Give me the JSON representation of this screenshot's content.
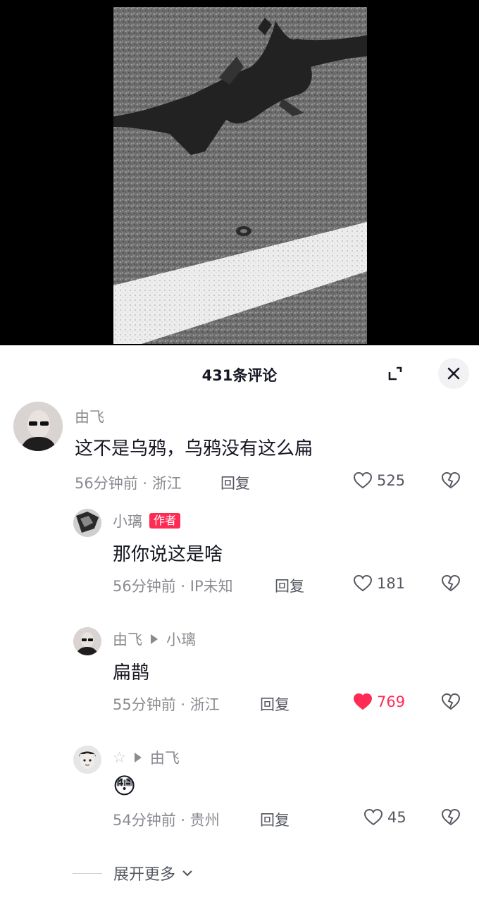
{
  "header": {
    "comment_count_title": "431条评论"
  },
  "icons": {
    "expand": "expand-icon",
    "close": "close-icon",
    "like": "heart-icon",
    "dislike": "broken-heart-icon",
    "chevron": "chevron-down-icon"
  },
  "colors": {
    "liked": "#fe2c55",
    "muted": "#8a8b91",
    "text": "#161823"
  },
  "comments": [
    {
      "user": "由飞",
      "text": "这不是乌鸦，乌鸦没有这么扁",
      "meta": "56分钟前 · 浙江",
      "reply_label": "回复",
      "likes": "525",
      "liked": false
    },
    {
      "user": "小璃",
      "badge": "作者",
      "text": "那你说这是啥",
      "meta": "56分钟前 · IP未知",
      "reply_label": "回复",
      "likes": "181",
      "liked": false
    },
    {
      "user": "由飞",
      "reply_to": "小璃",
      "text": "扁鹊",
      "meta": "55分钟前 · 浙江",
      "reply_label": "回复",
      "likes": "769",
      "liked": true
    },
    {
      "user": "☆",
      "reply_to": "由飞",
      "text": "😳",
      "meta": "54分钟前 · 贵州",
      "reply_label": "回复",
      "likes": "45",
      "liked": false
    }
  ],
  "footer": {
    "expand_more_label": "展开更多"
  }
}
